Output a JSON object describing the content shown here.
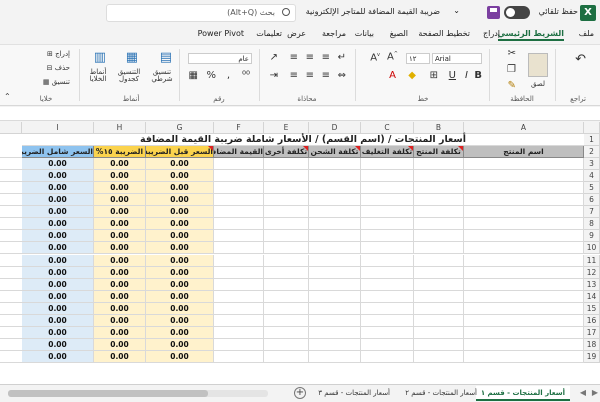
{
  "titlebar": {
    "autosave_label": "حفظ تلقائي",
    "file_name": "ضريبة القيمة المضافة للمتاجر الإلكترونية",
    "search_placeholder": "بحث (Alt+Q)"
  },
  "tabs": [
    "ملف",
    "الشريط الرئيسي",
    "إدراج",
    "تخطيط الصفحة",
    "الصيغ",
    "بيانات",
    "مراجعة",
    "عرض",
    "تعليمات",
    "Power Pivot"
  ],
  "active_tab": "الشريط الرئيسي",
  "ribbon": {
    "groups": {
      "undo": "تراجع",
      "clipboard": "الحافظة",
      "font": "خط",
      "alignment": "محاذاة",
      "number": "رقم",
      "styles": "أنماط",
      "cells": "خلايا"
    },
    "paste_label": "لصق",
    "font_name": "Arial",
    "font_size": "١٢",
    "number_format": "عام",
    "conditional_formatting": "تنسيق شرطي",
    "format_as_table": "التنسيق كجدول",
    "cell_styles": "أنماط الخلايا",
    "insert": "إدراج",
    "delete": "حذف",
    "format": "تنسيق"
  },
  "columns": [
    "A",
    "B",
    "C",
    "D",
    "E",
    "F",
    "G",
    "H",
    "I"
  ],
  "rows": [
    "1",
    "2",
    "3",
    "4",
    "5",
    "6",
    "7",
    "8",
    "9",
    "10",
    "11",
    "12",
    "13",
    "14",
    "15",
    "16",
    "17",
    "18",
    "19"
  ],
  "sheet": {
    "title": "أسعار المنتجات / (اسم القسم) / الأسعار شاملة ضريبة القيمة المضافة",
    "headers": {
      "A": "اسم المنتج",
      "B": "تكلفة المنتج",
      "C": "تكلفة التغليف",
      "D": "تكلفة الشحن",
      "E": "تكلفة أخرى",
      "F": "القيمة المضافة",
      "G": "السعر قبل الضريبة",
      "H": "الضريبة ١٥%",
      "I": "السعر شامل الضريبة"
    },
    "zero_value": "0.00"
  },
  "sheet_tabs": [
    "أسعار المنتجات - قسم ١",
    "أسعار المنتجات - قسم ٢",
    "أسعار المنتجات - قسم ٣"
  ],
  "active_sheet": "أسعار المنتجات - قسم ١",
  "colors": {
    "accent": "#1d6f42",
    "header_gray": "#bfbfbf",
    "header_yellow": "#fbd34d",
    "header_blue": "#8ec3ef",
    "value_yellow": "#fff2cc",
    "value_blue": "#ddebf7"
  }
}
